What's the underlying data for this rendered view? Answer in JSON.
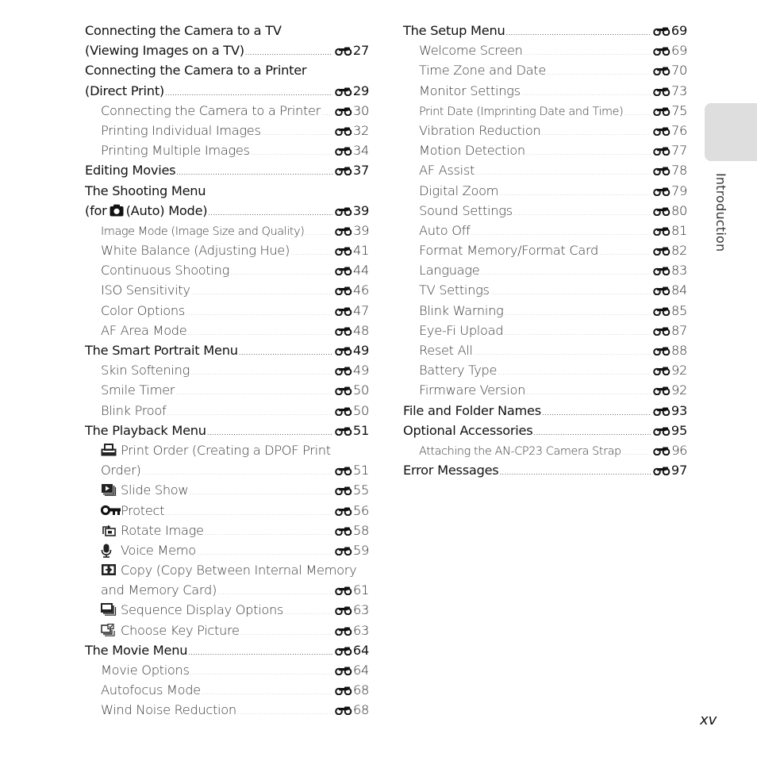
{
  "page": {
    "side_tab_label": "Introduction",
    "page_number": "xv",
    "ref_icon": "binoculars-reference-icon",
    "ref_prefix": "E"
  },
  "left_column": [
    {
      "level": 1,
      "label": "Connecting the Camera to a TV",
      "page": ""
    },
    {
      "level": 1,
      "label": "(Viewing Images on a TV)",
      "page": "27"
    },
    {
      "level": 1,
      "label": "Connecting the Camera to a Printer",
      "page": ""
    },
    {
      "level": 1,
      "label": "(Direct Print)",
      "page": "29"
    },
    {
      "level": 2,
      "label": "Connecting the Camera to a Printer",
      "page": "30"
    },
    {
      "level": 2,
      "label": "Printing Individual Images",
      "page": "32"
    },
    {
      "level": 2,
      "label": "Printing Multiple Images",
      "page": "34"
    },
    {
      "level": 1,
      "label": "Editing Movies",
      "page": "37"
    },
    {
      "level": 1,
      "label": "The Shooting Menu",
      "page": ""
    },
    {
      "level": 1,
      "label_pre": "(for",
      "inline_icon": "camera-icon",
      "label": "(Auto) Mode)",
      "page": "39"
    },
    {
      "level": 2,
      "label": "Image Mode (Image Size and Quality)",
      "page": "39",
      "small": true
    },
    {
      "level": 2,
      "label": "White Balance (Adjusting Hue)",
      "page": "41"
    },
    {
      "level": 2,
      "label": "Continuous Shooting",
      "page": "44"
    },
    {
      "level": 2,
      "label": "ISO Sensitivity",
      "page": "46"
    },
    {
      "level": 2,
      "label": "Color Options",
      "page": "47"
    },
    {
      "level": 2,
      "label": "AF Area Mode",
      "page": "48"
    },
    {
      "level": 1,
      "label": "The Smart Portrait Menu",
      "page": "49"
    },
    {
      "level": 2,
      "label": "Skin Softening",
      "page": "49"
    },
    {
      "level": 2,
      "label": "Smile Timer",
      "page": "50"
    },
    {
      "level": 2,
      "label": "Blink Proof",
      "page": "50"
    },
    {
      "level": 1,
      "label": "The Playback Menu",
      "page": "51"
    },
    {
      "level": 2,
      "icon": "print-order-icon",
      "label": "Print Order (Creating a DPOF Print",
      "page": ""
    },
    {
      "level": 2,
      "label": "Order)",
      "page": "51"
    },
    {
      "level": 2,
      "icon": "slide-show-icon",
      "label": "Slide Show",
      "page": "55"
    },
    {
      "level": 2,
      "icon": "protect-key-icon",
      "label": "Protect",
      "page": "56"
    },
    {
      "level": 2,
      "icon": "rotate-image-icon",
      "label": "Rotate Image",
      "page": "58"
    },
    {
      "level": 2,
      "icon": "voice-memo-microphone-icon",
      "label": "Voice Memo",
      "page": "59"
    },
    {
      "level": 2,
      "icon": "copy-icon",
      "label": "Copy (Copy Between Internal Memory",
      "page": ""
    },
    {
      "level": 2,
      "label": "and Memory Card)",
      "page": "61"
    },
    {
      "level": 2,
      "icon": "sequence-display-icon",
      "label": "Sequence Display Options",
      "page": "63"
    },
    {
      "level": 2,
      "icon": "choose-key-picture-icon",
      "label": "Choose Key Picture",
      "page": "63"
    },
    {
      "level": 1,
      "label": "The Movie Menu",
      "page": "64"
    },
    {
      "level": 2,
      "label": "Movie Options",
      "page": "64"
    },
    {
      "level": 2,
      "label": "Autofocus Mode",
      "page": "68"
    },
    {
      "level": 2,
      "label": "Wind Noise Reduction",
      "page": "68"
    }
  ],
  "right_column": [
    {
      "level": 1,
      "label": "The Setup Menu",
      "page": "69"
    },
    {
      "level": 2,
      "label": "Welcome Screen",
      "page": "69"
    },
    {
      "level": 2,
      "label": "Time Zone and Date",
      "page": "70"
    },
    {
      "level": 2,
      "label": "Monitor Settings",
      "page": "73"
    },
    {
      "level": 2,
      "label": "Print Date (Imprinting Date and Time)",
      "page": "75",
      "small": true
    },
    {
      "level": 2,
      "label": "Vibration Reduction",
      "page": "76"
    },
    {
      "level": 2,
      "label": "Motion Detection",
      "page": "77"
    },
    {
      "level": 2,
      "label": "AF Assist",
      "page": "78"
    },
    {
      "level": 2,
      "label": "Digital Zoom",
      "page": "79"
    },
    {
      "level": 2,
      "label": "Sound Settings",
      "page": "80"
    },
    {
      "level": 2,
      "label": "Auto Off",
      "page": "81"
    },
    {
      "level": 2,
      "label": "Format Memory/Format Card",
      "page": "82"
    },
    {
      "level": 2,
      "label": "Language",
      "page": "83"
    },
    {
      "level": 2,
      "label": "TV Settings",
      "page": "84"
    },
    {
      "level": 2,
      "label": "Blink Warning",
      "page": "85"
    },
    {
      "level": 2,
      "label": "Eye-Fi Upload",
      "page": "87"
    },
    {
      "level": 2,
      "label": "Reset All",
      "page": "88"
    },
    {
      "level": 2,
      "label": "Battery Type",
      "page": "92"
    },
    {
      "level": 2,
      "label": "Firmware Version",
      "page": "92"
    },
    {
      "level": 1,
      "label": "File and Folder Names",
      "page": "93"
    },
    {
      "level": 1,
      "label": "Optional Accessories",
      "page": "95"
    },
    {
      "level": 2,
      "label": "Attaching the AN-CP23 Camera Strap",
      "page": "96",
      "small": true
    },
    {
      "level": 1,
      "label": "Error Messages",
      "page": "97"
    }
  ]
}
